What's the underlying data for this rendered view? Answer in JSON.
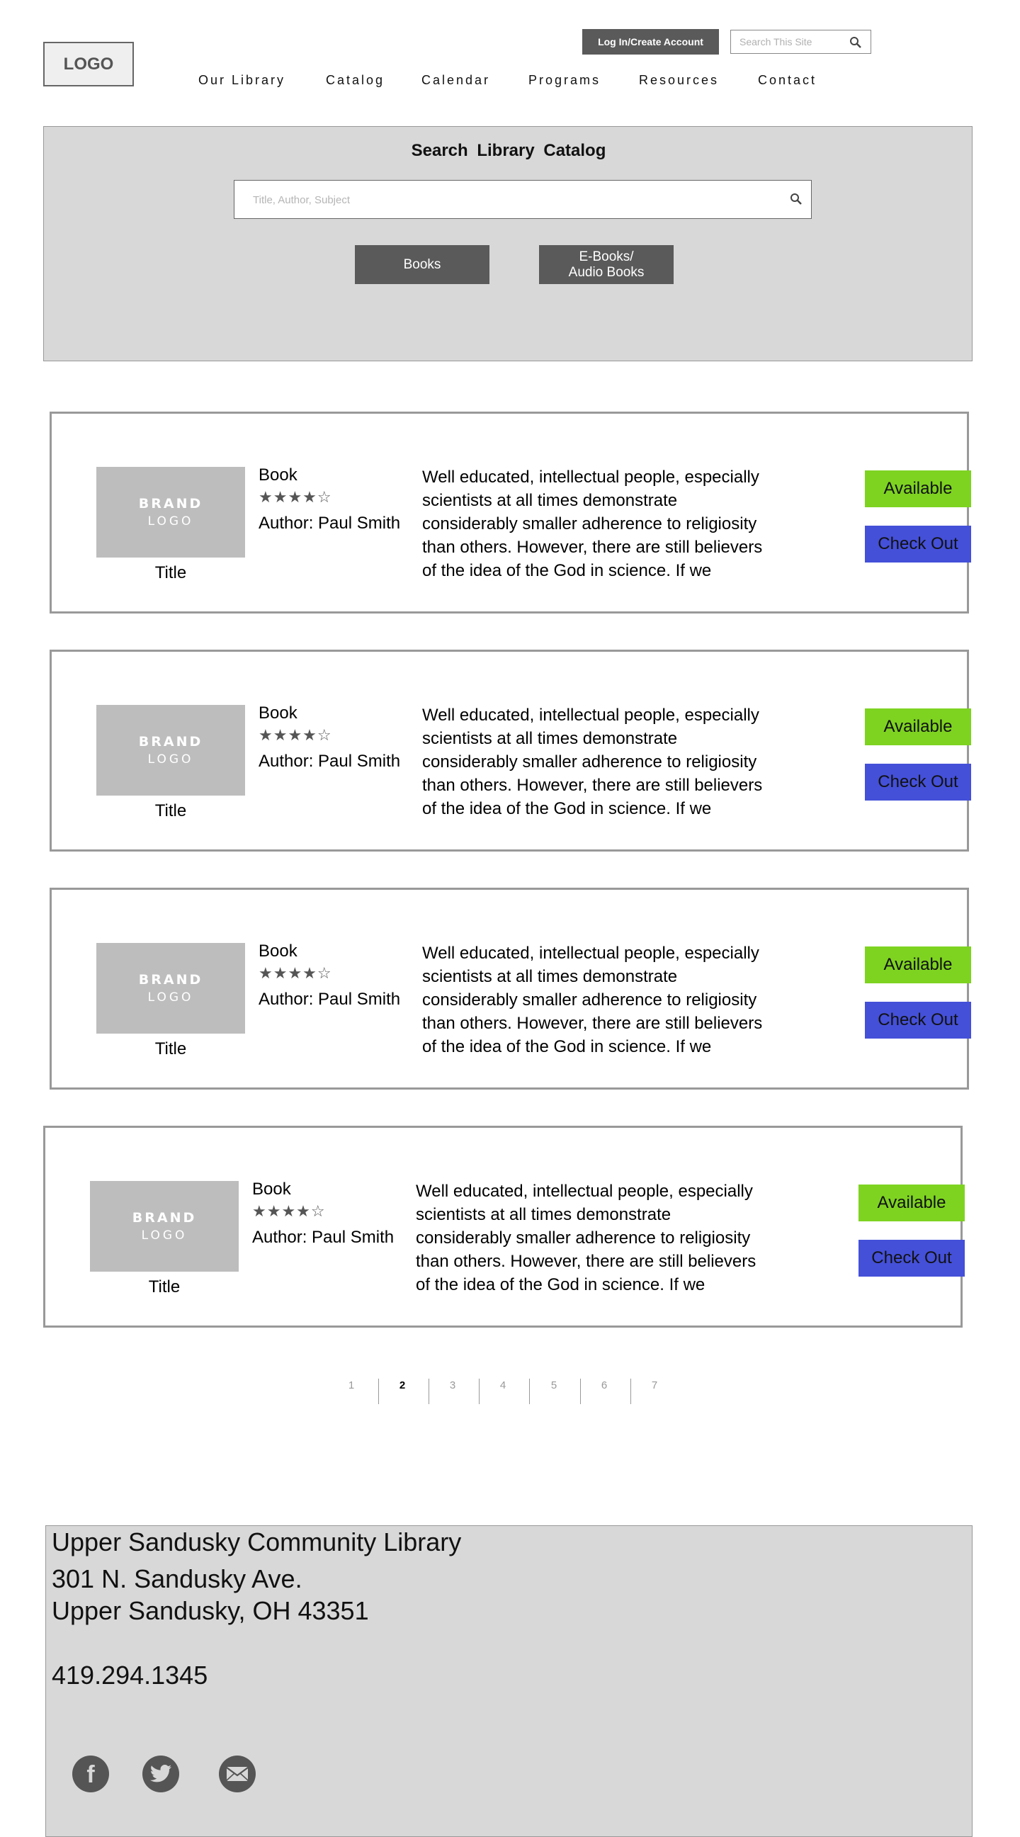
{
  "header": {
    "logo_text": "LOGO",
    "login_label": "Log In/Create Account",
    "site_search_placeholder": "Search This Site",
    "nav": [
      "Our Library",
      "Catalog",
      "Calendar",
      "Programs",
      "Resources",
      "Contact"
    ]
  },
  "catalog": {
    "title": "Search Library Catalog",
    "search_placeholder": "Title, Author, Subject",
    "buttons": {
      "books": "Books",
      "ebooks_line1": "E-Books/",
      "ebooks_line2": "Audio Books"
    }
  },
  "results": [
    {
      "brand_line1": "BRAND",
      "brand_line2": "LOGO",
      "title": "Title",
      "type": "Book",
      "rating": 4,
      "rating_max": 5,
      "rating_stars": "★★★★☆",
      "author": "Author: Paul Smith",
      "description": "Well educated, intellectual people, especially scientists at all times demonstrate considerably smaller adherence to religiosity than others. However, there are still believers of the idea of the God in science. If we",
      "status": "Available",
      "action": "Check Out"
    },
    {
      "brand_line1": "BRAND",
      "brand_line2": "LOGO",
      "title": "Title",
      "type": "Book",
      "rating": 4,
      "rating_max": 5,
      "rating_stars": "★★★★☆",
      "author": "Author: Paul Smith",
      "description": "Well educated, intellectual people, especially scientists at all times demonstrate considerably smaller adherence to religiosity than others. However, there are still believers of the idea of the God in science. If we",
      "status": "Available",
      "action": "Check Out"
    },
    {
      "brand_line1": "BRAND",
      "brand_line2": "LOGO",
      "title": "Title",
      "type": "Book",
      "rating": 4,
      "rating_max": 5,
      "rating_stars": "★★★★☆",
      "author": "Author: Paul Smith",
      "description": "Well educated, intellectual people, especially scientists at all times demonstrate considerably smaller adherence to religiosity than others. However, there are still believers of the idea of the God in science. If we",
      "status": "Available",
      "action": "Check Out"
    },
    {
      "brand_line1": "BRAND",
      "brand_line2": "LOGO",
      "title": "Title",
      "type": "Book",
      "rating": 4,
      "rating_max": 5,
      "rating_stars": "★★★★☆",
      "author": "Author: Paul Smith",
      "description": "Well educated, intellectual people, especially scientists at all times demonstrate considerably smaller adherence to religiosity than others. However, there are still believers of the idea of the God in science. If we",
      "status": "Available",
      "action": "Check Out"
    }
  ],
  "pagination": {
    "pages": [
      "1",
      "2",
      "3",
      "4",
      "5",
      "6",
      "7"
    ],
    "current": "2"
  },
  "footer": {
    "name": "Upper Sandusky Community Library",
    "address1": "301 N. Sandusky Ave.",
    "address2": "Upper Sandusky, OH 43351",
    "phone": "419.294.1345",
    "social": [
      "facebook-icon",
      "twitter-icon",
      "email-icon"
    ]
  },
  "colors": {
    "available": "#7ed321",
    "checkout": "#4450d8",
    "panel_gray": "#d8d8d8",
    "dark_button": "#5a5a5a"
  }
}
